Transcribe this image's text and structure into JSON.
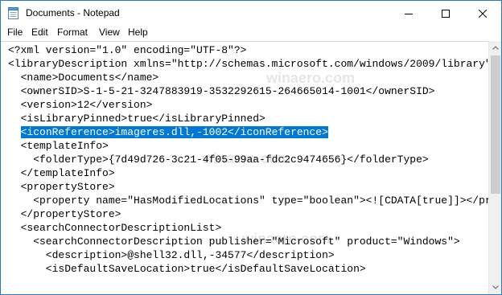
{
  "window": {
    "title": "Documents - Notepad"
  },
  "menu": {
    "items": [
      "File",
      "Edit",
      "Format",
      "View",
      "Help"
    ]
  },
  "colors": {
    "selection": "#0078d7",
    "scroll_thumb": "#cdcdcd",
    "border": "#2b78c9"
  },
  "icons": {
    "app": "notepad-icon",
    "minimize": "minimize-icon",
    "maximize": "maximize-icon",
    "close": "close-icon",
    "scroll_up": "chevron-up-icon",
    "scroll_down": "chevron-down-icon"
  },
  "editor": {
    "lines": [
      "<?xml version=\"1.0\" encoding=\"UTF-8\"?>",
      "<libraryDescription xmlns=\"http://schemas.microsoft.com/windows/2009/library\"",
      "  <name>Documents</name>",
      "  <ownerSID>S-1-5-21-3247883919-3532292615-264665014-1001</ownerSID>",
      "  <version>12</version>",
      "  <isLibraryPinned>true</isLibraryPinned>",
      "  <iconReference>imageres.dll,-1002</iconReference>",
      "  <templateInfo>",
      "    <folderType>{7d49d726-3c21-4f05-99aa-fdc2c9474656}</folderType>",
      "  </templateInfo>",
      "  <propertyStore>",
      "    <property name=\"HasModifiedLocations\" type=\"boolean\"><![CDATA[true]]></pr",
      "  </propertyStore>",
      "  <searchConnectorDescriptionList>",
      "    <searchConnectorDescription publisher=\"Microsoft\" product=\"Windows\">",
      "      <description>@shell32.dll,-34577</description>",
      "      <isDefaultSaveLocation>true</isDefaultSaveLocation>"
    ],
    "selected_line_indent": "  ",
    "selected_text": "<iconReference>imageres.dll,-1002</iconReference>"
  },
  "watermark": "winaero.com"
}
